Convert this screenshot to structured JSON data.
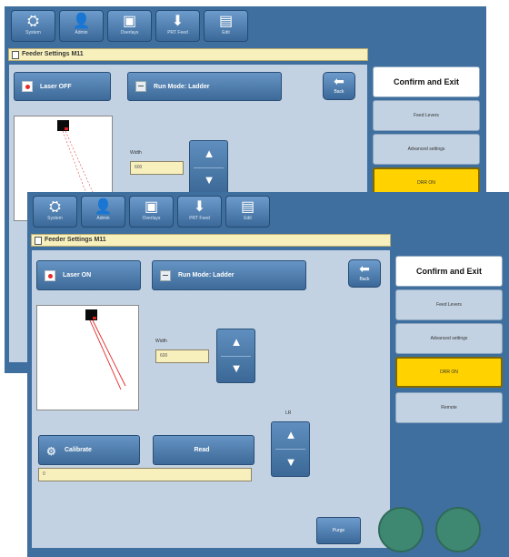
{
  "back_screen": {
    "toolbar": [
      {
        "label": "System",
        "icon": "system-icon"
      },
      {
        "label": "Admin",
        "icon": "user-icon"
      },
      {
        "label": "Overlays",
        "icon": "overlay-icon"
      },
      {
        "label": "PRT Feed",
        "icon": "feed-icon"
      },
      {
        "label": "Edit",
        "icon": "disk-icon"
      }
    ],
    "title": "Feeder Settings M11",
    "laser_button": "Laser OFF",
    "mode_button": "Run Mode: Ladder",
    "back_label": "Back",
    "width_label": "Width",
    "width_value": "600",
    "side_buttons": [
      "Confirm and Exit",
      "Feed Levers",
      "Advanced settings",
      "DRR ON"
    ]
  },
  "front_screen": {
    "toolbar": [
      {
        "label": "System",
        "icon": "system-icon"
      },
      {
        "label": "Admin",
        "icon": "user-icon"
      },
      {
        "label": "Overlays",
        "icon": "overlay-icon"
      },
      {
        "label": "PRT Feed",
        "icon": "feed-icon"
      },
      {
        "label": "Edit",
        "icon": "disk-icon"
      }
    ],
    "title": "Feeder Settings M11",
    "laser_button": "Laser ON",
    "mode_button": "Run Mode: Ladder",
    "back_label": "Back",
    "width_label": "Width",
    "width_value": "600",
    "calibrate_button": "Calibrate",
    "read_button": "Read",
    "lr_label": "LR",
    "readout_value": "0",
    "side_buttons": [
      "Confirm and Exit",
      "Feed Levers",
      "Advanced settings",
      "DRR ON",
      "Remote"
    ],
    "purge_button": "Purge"
  }
}
